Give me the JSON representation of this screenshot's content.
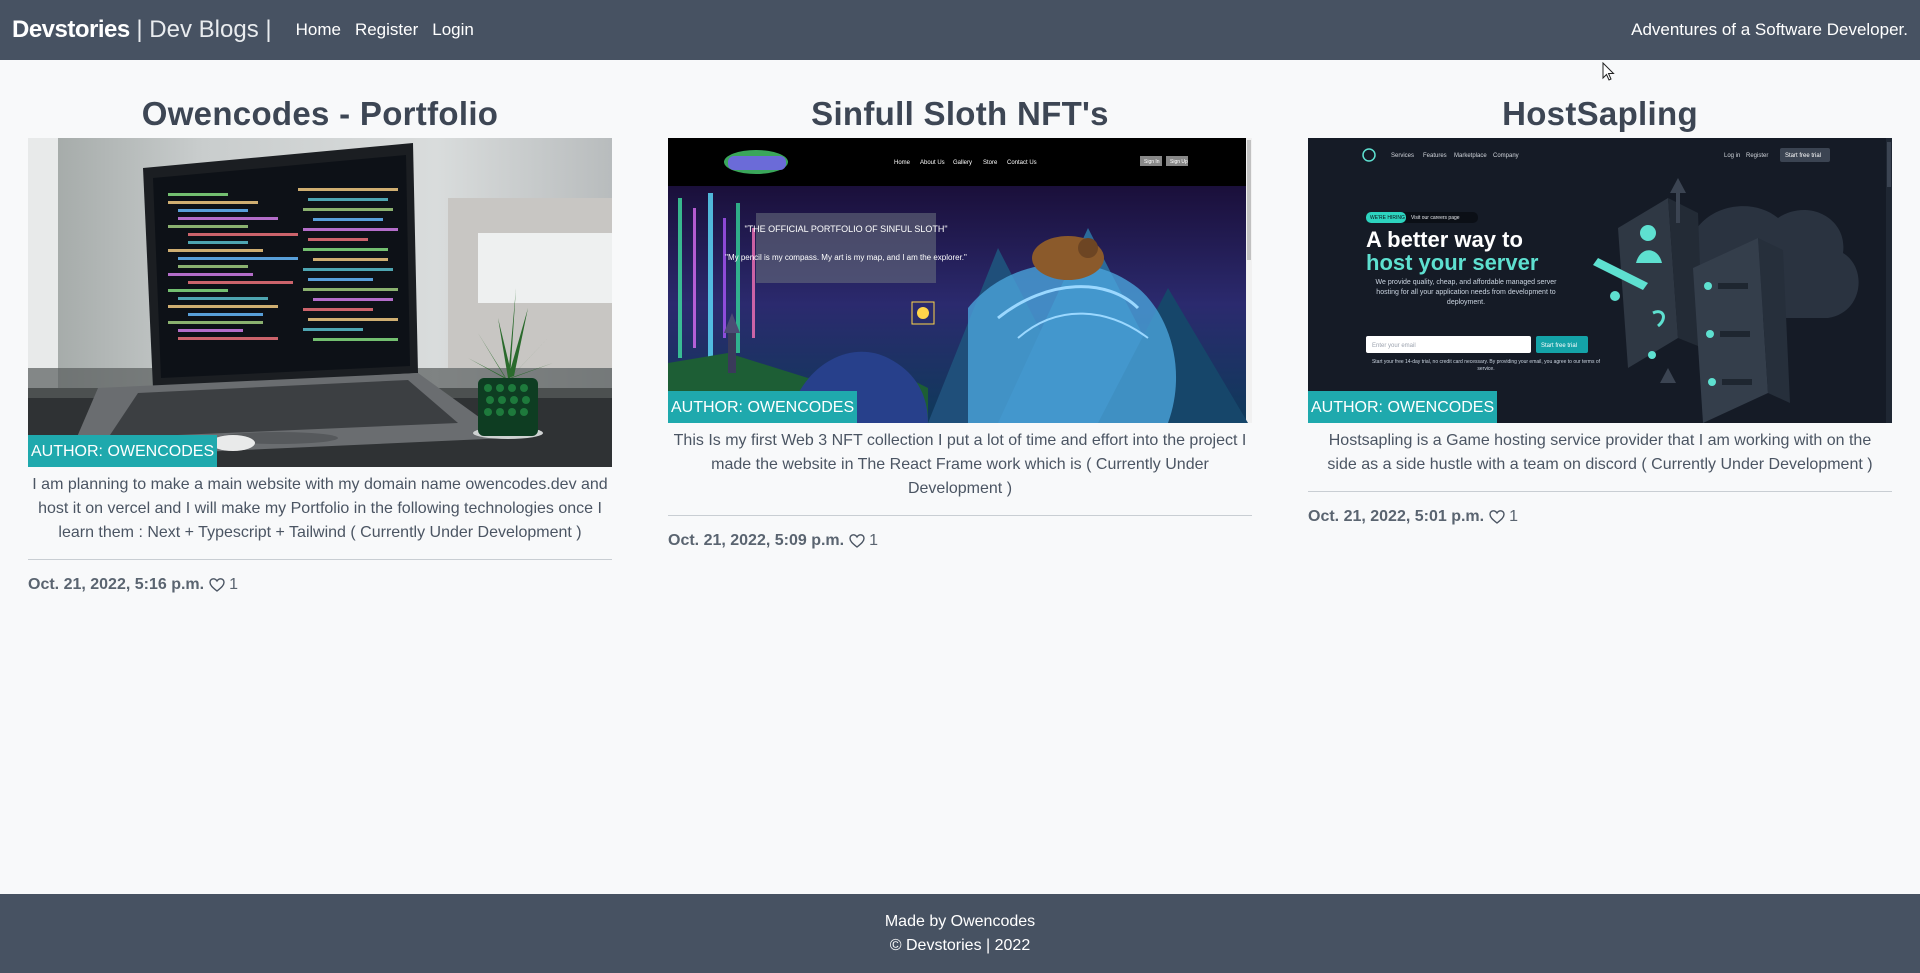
{
  "navbar": {
    "brand_strong": "Devstories",
    "brand_rest": " | Dev Blogs |",
    "links": [
      "Home",
      "Register",
      "Login"
    ],
    "tagline": "Adventures of a Software Developer."
  },
  "colors": {
    "navbar_bg": "#475262",
    "badge_bg": "#1fa9ad",
    "page_bg": "#f8f9fa"
  },
  "posts": [
    {
      "title": "Owencodes - Portfolio",
      "author_badge": "AUTHOR: OWENCODES",
      "description": "I am planning to make a main website with my domain name owencodes.dev and host it on vercel and I will make my Portfolio in the following technologies once I learn them : Next + Typescript + Tailwind ( Currently Under Development )",
      "date": "Oct. 21, 2022, 5:16 p.m.",
      "likes": "1",
      "like_icon": "heart-icon"
    },
    {
      "title": "Sinfull Sloth NFT's",
      "author_badge": "AUTHOR: OWENCODES",
      "description": "This Is my first Web 3 NFT collection I put a lot of time and effort into the project I made the website in The React Frame work which is ( Currently Under Development )",
      "date": "Oct. 21, 2022, 5:09 p.m.",
      "likes": "1",
      "like_icon": "heart-icon",
      "image_text": {
        "nav": [
          "Home",
          "About Us",
          "Gallery",
          "Store",
          "Contact Us"
        ],
        "buttons": [
          "Sign In",
          "Sign Up"
        ],
        "heading": "\"THE OFFICIAL PORTFOLIO OF SINFUL SLOTH\"",
        "quote": "\"My pencil is my compass. My art is my map, and I am the explorer.\""
      }
    },
    {
      "title": "HostSapling",
      "author_badge": "AUTHOR: OWENCODES",
      "description": "Hostsapling is a Game hosting service provider that I am working with on the side as a side hustle with a team on discord ( Currently Under Development )",
      "date": "Oct. 21, 2022, 5:01 p.m.",
      "likes": "1",
      "like_icon": "heart-icon",
      "image_text": {
        "nav": [
          "Services",
          "Features",
          "Marketplace",
          "Company"
        ],
        "login": "Log in",
        "register": "Register",
        "trial_btn": "Start free trial",
        "pill_tag": "WE'RE HIRING",
        "pill_text": "Visit our careers page",
        "headline1": "A better way to",
        "headline2": "host your server",
        "body": "We provide quality, cheap, and affordable managed server hosting for all your application needs from development to deployment.",
        "email_placeholder": "Enter your email",
        "cta": "Start free trial",
        "fine_print": "Start your free 14-day trial, no credit card necessary. By providing your email, you agree to our terms of service."
      }
    }
  ],
  "footer": {
    "line1": "Made by Owencodes",
    "line2": "© Devstories | 2022"
  }
}
